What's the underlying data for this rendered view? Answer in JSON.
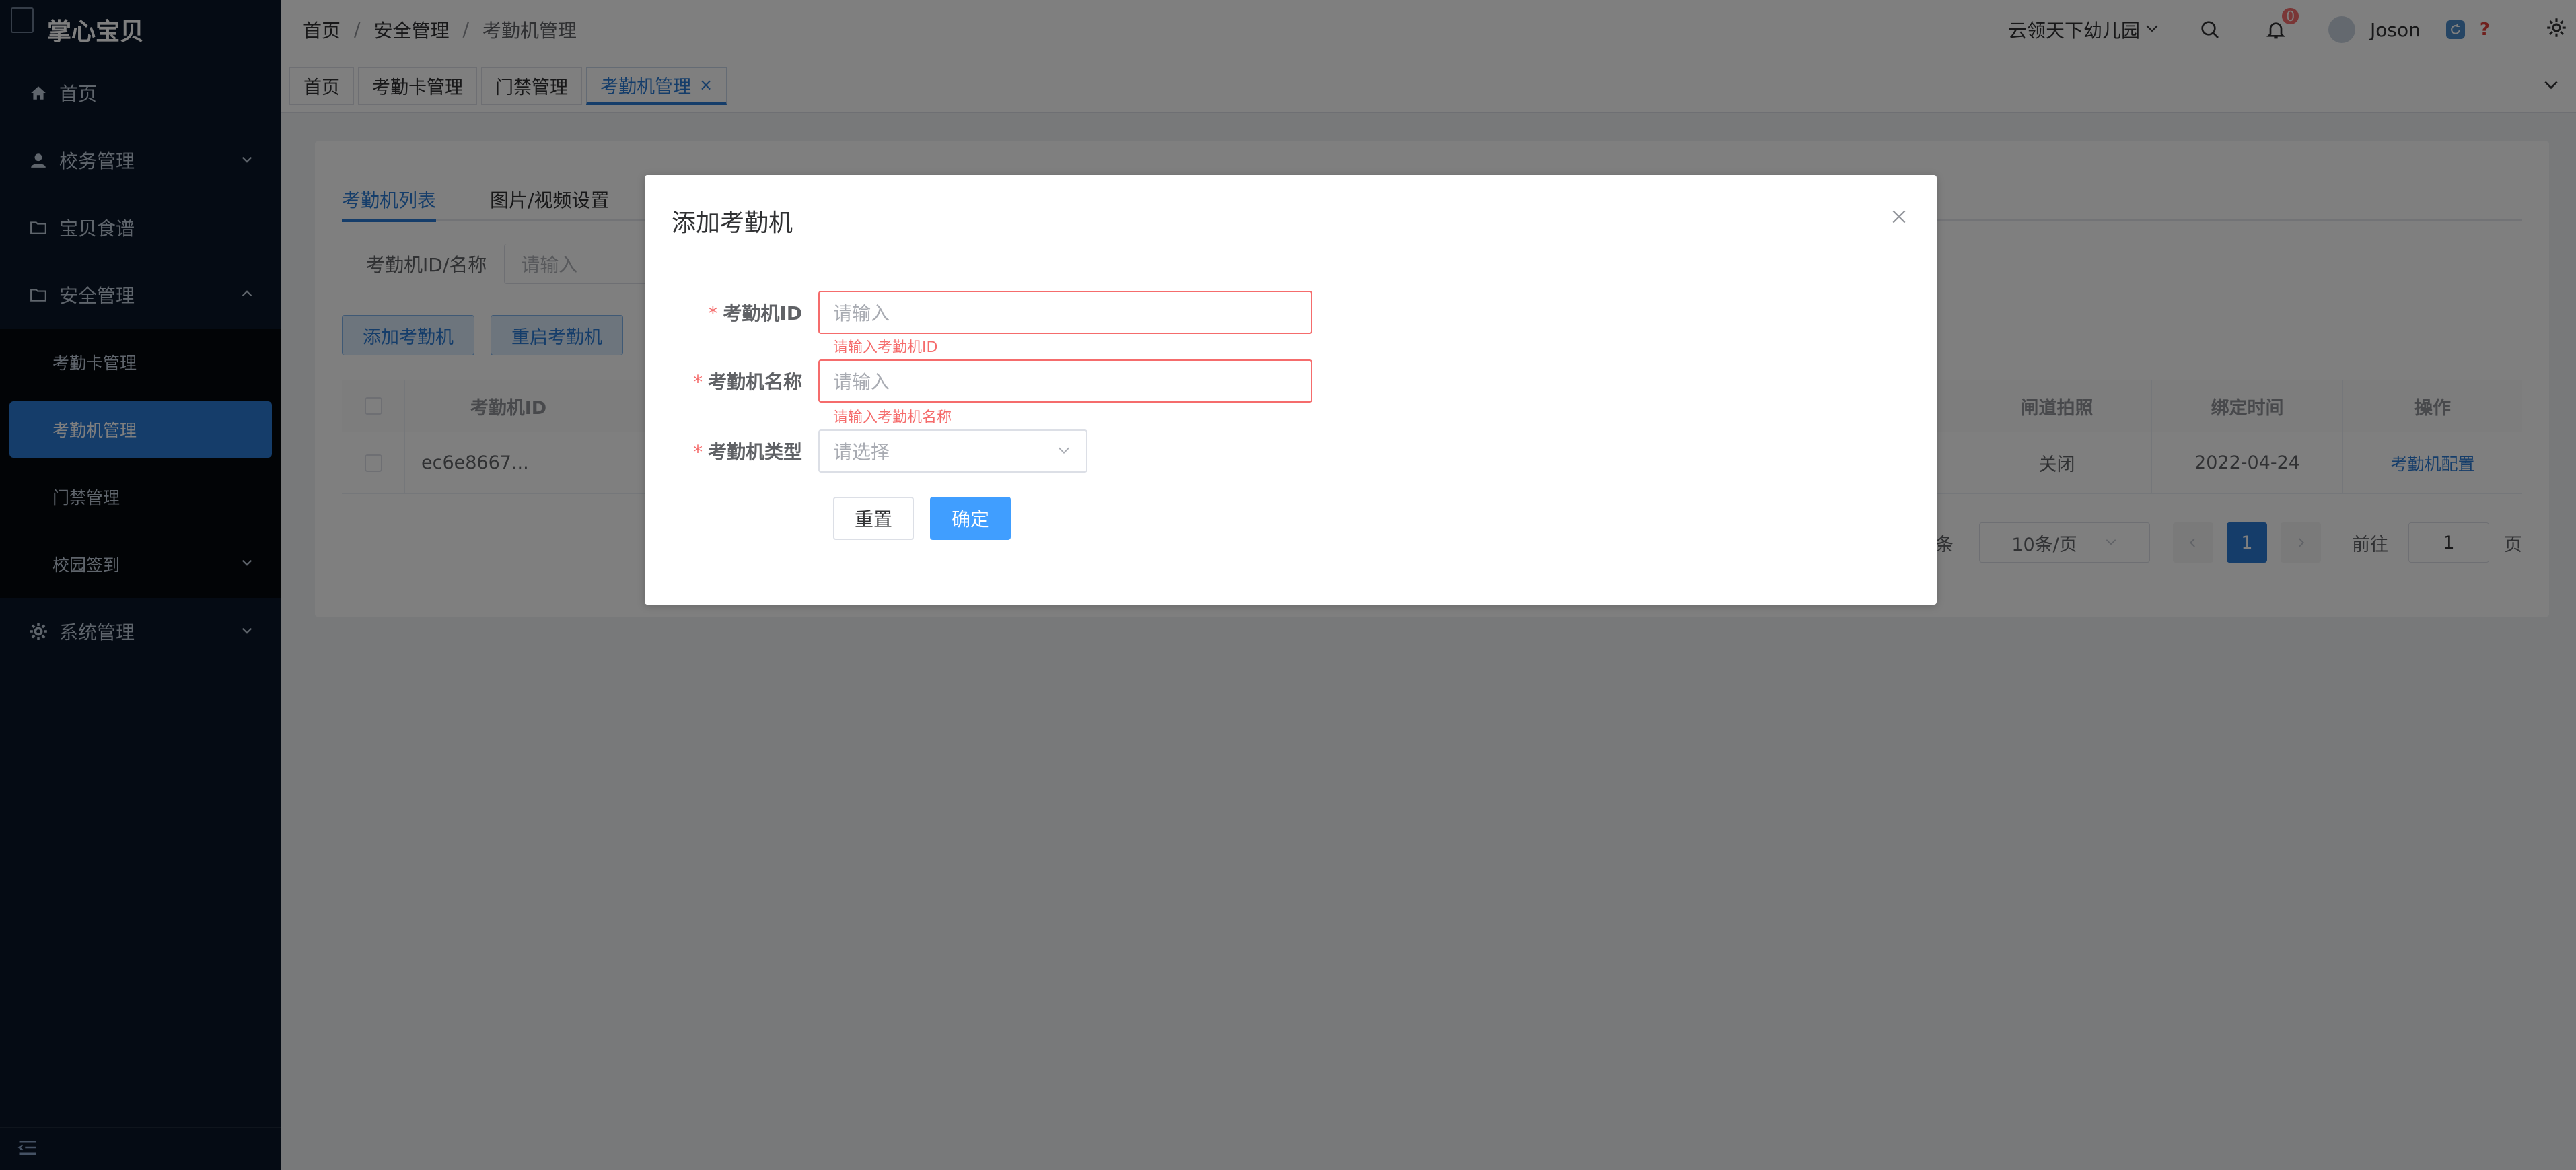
{
  "app": {
    "logo_text": "掌心宝贝"
  },
  "sidebar": {
    "items": [
      {
        "label": "首页",
        "icon": "home-icon"
      },
      {
        "label": "校务管理",
        "icon": "user-icon"
      },
      {
        "label": "宝贝食谱",
        "icon": "folder-icon"
      },
      {
        "label": "安全管理",
        "icon": "folder-icon"
      }
    ],
    "security_sub": [
      {
        "label": "考勤卡管理"
      },
      {
        "label": "考勤机管理"
      },
      {
        "label": "门禁管理"
      },
      {
        "label": "校园签到"
      }
    ],
    "system": {
      "label": "系统管理",
      "icon": "gear-icon"
    }
  },
  "header": {
    "breadcrumb": [
      "首页",
      "安全管理",
      "考勤机管理"
    ],
    "breadcrumb_sep": "/",
    "school": "云领天下幼儿园",
    "notifications": "0",
    "user": "Joson",
    "help": "?"
  },
  "tabs": [
    "首页",
    "考勤卡管理",
    "门禁管理",
    "考勤机管理"
  ],
  "tab_close": "×",
  "page": {
    "inner_tabs": [
      "考勤机列表",
      "图片/视频设置"
    ],
    "filter_label": "考勤机ID/名称",
    "filter_placeholder": "请输入",
    "buttons": {
      "add": "添加考勤机",
      "restart": "重启考勤机"
    },
    "table": {
      "headers": {
        "id": "考勤机ID",
        "gate": "闸道拍照",
        "bind_time": "绑定时间",
        "action": "操作"
      },
      "rows": [
        {
          "id": "ec6e8667...",
          "gate": "关闭",
          "bind_time": "2022-04-24",
          "action": "考勤机配置"
        }
      ]
    },
    "pager": {
      "total": "1 条",
      "size": "10条/页",
      "current": "1",
      "goto": "前往",
      "goto_value": "1",
      "page_unit": "页"
    }
  },
  "dialog": {
    "title": "添加考勤机",
    "required_mark": "*",
    "fields": {
      "id": {
        "label": "考勤机ID",
        "placeholder": "请输入",
        "error": "请输入考勤机ID"
      },
      "name": {
        "label": "考勤机名称",
        "placeholder": "请输入",
        "error": "请输入考勤机名称"
      },
      "type": {
        "label": "考勤机类型",
        "placeholder": "请选择"
      }
    },
    "reset": "重置",
    "confirm": "确定"
  },
  "colors": {
    "sidebar_bg": "#0a1628",
    "primary": "#2b7bd4",
    "danger": "#f56c6c",
    "confirm": "#409eff"
  }
}
